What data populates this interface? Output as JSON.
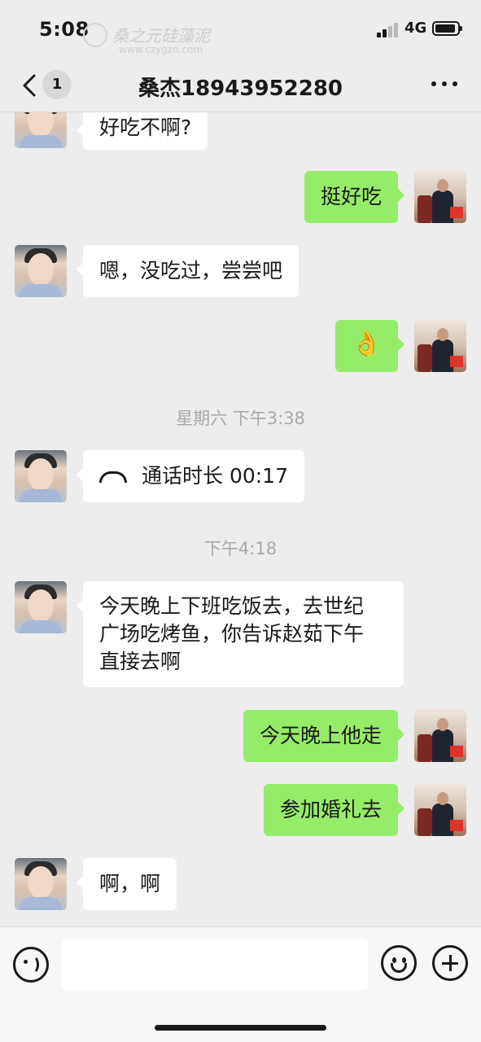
{
  "status_bar": {
    "time": "5:08",
    "network": "4G",
    "watermark_text": "桑之元硅藻泥",
    "watermark_url": "www.czygzn.com"
  },
  "nav": {
    "back_count": "1",
    "title": "桑杰18943952280"
  },
  "messages": [
    {
      "side": "left",
      "text": "好吃不啊?"
    },
    {
      "side": "right",
      "text": "挺好吃"
    },
    {
      "side": "left",
      "text": "嗯，没吃过，尝尝吧"
    },
    {
      "side": "right",
      "text": "👌"
    },
    {
      "type": "timestamp",
      "text": "星期六 下午3:38"
    },
    {
      "side": "left",
      "type": "call",
      "text": "通话时长 00:17"
    },
    {
      "type": "timestamp",
      "text": "下午4:18"
    },
    {
      "side": "left",
      "lines": [
        "今天晚上下班吃饭去，去世纪",
        "广场吃烤鱼，你告诉赵茹下午",
        "直接去啊"
      ]
    },
    {
      "side": "right",
      "text": "今天晚上他走"
    },
    {
      "side": "right",
      "text": "参加婚礼去"
    },
    {
      "side": "left",
      "text": "啊，啊"
    }
  ],
  "input": {
    "value": ""
  },
  "colors": {
    "background": "#ededed",
    "bubble_sent": "#95ec69",
    "bubble_received": "#ffffff"
  }
}
